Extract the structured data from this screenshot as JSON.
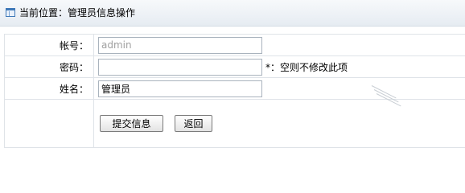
{
  "breadcrumb": {
    "icon": "window-icon",
    "title": "当前位置：管理员信息操作"
  },
  "form": {
    "account_label": "帐号：",
    "account_value": "admin",
    "password_label": "密码：",
    "password_value": "",
    "password_note": "*：空则不修改此项",
    "name_label": "姓名：",
    "name_value": "管理员",
    "submit_label": "提交信息",
    "back_label": "返回"
  }
}
